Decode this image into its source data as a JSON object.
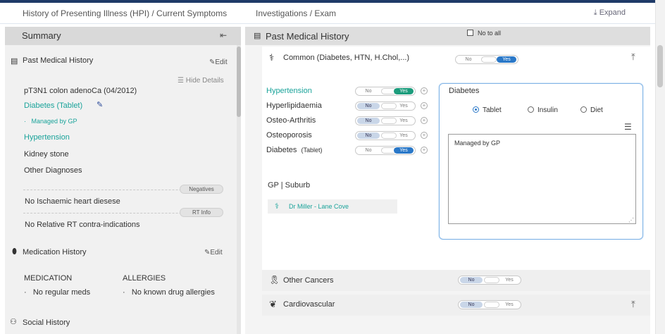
{
  "top_tabs": {
    "hpi": "History of Presenting Illness (HPI) / Current Symptoms",
    "investigations": "Investigations / Exam",
    "expand": "Expand"
  },
  "summary": {
    "title": "Summary",
    "collapse_icon": "⇤",
    "pmh": {
      "title": "Past Medical History",
      "edit": "Edit",
      "hide_details": "Hide Details",
      "items": [
        "pT3N1 colon adenoCa (04/2012)",
        "Diabetes (Tablet)",
        "Managed by GP",
        "Hypertension",
        "Kidney stone",
        "Other Diagnoses"
      ],
      "negatives_label": "Negatives",
      "negatives_text": "No Ischaemic heart diesese",
      "rt_label": "RT Info",
      "rt_text": "No Relative RT contra-indications"
    },
    "medication": {
      "title": "Medication History",
      "edit": "Edit",
      "col1_header": "MEDICATION",
      "col2_header": "ALLERGIES",
      "col1_item": "No regular meds",
      "col2_item": "No known drug allergies"
    },
    "social": {
      "title": "Social History"
    }
  },
  "pmh_panel": {
    "title": "Past Medical History",
    "no_to_all": "No to all",
    "common_title": "Common (Diabetes, HTN, H.Chol,...)",
    "toggle_no": "No",
    "toggle_yes": "Yes",
    "conditions": [
      {
        "label": "Hypertension",
        "state": "yes"
      },
      {
        "label": "Hyperlipidaemia",
        "state": "no"
      },
      {
        "label": "Osteo-Arthritis",
        "state": "no"
      },
      {
        "label": "Osteoporosis",
        "state": "no"
      },
      {
        "label": "Diabetes",
        "suffix": "(Tablet)",
        "state": "yes"
      }
    ],
    "gp_label": "GP | Suburb",
    "gp_value": "Dr Miller - Lane Cove",
    "diabetes_box": {
      "title": "Diabetes",
      "options": [
        "Tablet",
        "Insulin",
        "Diet"
      ],
      "selected": "Tablet",
      "notes": "Managed by GP"
    },
    "other_cancers": "Other Cancers",
    "cardiovascular": "Cardiovascular"
  },
  "colors": {
    "teal": "#1aa39a",
    "blue": "#2a78c8",
    "green": "#1c9c7c",
    "navy": "#1f3a68"
  }
}
